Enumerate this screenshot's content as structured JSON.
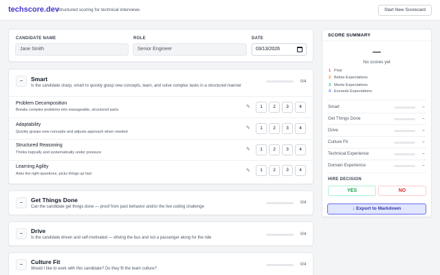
{
  "header": {
    "brand": "techscore.dev",
    "tagline": "Structured scoring for technical interviews",
    "new_button": "Start New Scorecard"
  },
  "candidate": {
    "name_label": "CANDIDATE NAME",
    "name_placeholder": "Jane Smith",
    "role_label": "ROLE",
    "role_placeholder": "Senior Engineer",
    "date_label": "DATE",
    "date_value": "03/13/2026"
  },
  "sections": [
    {
      "title": "Smart",
      "desc": "Is the candidate sharp, smart to quickly grasp new concepts, learn, and solve complex tasks in a structured manner",
      "count": "0/4",
      "collapse_glyph": "−",
      "criteria": [
        {
          "title": "Problem Decomposition",
          "desc": "Breaks complex problems into manageable, structured parts"
        },
        {
          "title": "Adaptability",
          "desc": "Quickly grasps new concepts and adjusts approach when needed"
        },
        {
          "title": "Structured Reasoning",
          "desc": "Thinks logically and systematically under pressure"
        },
        {
          "title": "Learning Agility",
          "desc": "Asks the right questions, picks things up fast"
        }
      ]
    },
    {
      "title": "Get Things Done",
      "desc": "Can the candidate get things done — proof from past behavior and/or the live coding challenge",
      "count": "0/4",
      "collapse_glyph": "−"
    },
    {
      "title": "Drive",
      "desc": "Is the candidate driven and self-motivated — driving the bus and not a passenger along for the ride",
      "count": "0/4",
      "collapse_glyph": "−"
    },
    {
      "title": "Culture Fit",
      "desc": "Would I like to work with this candidate? Do they fit the team culture?",
      "count": "0/4",
      "collapse_glyph": "−"
    }
  ],
  "score_options": [
    "1",
    "2",
    "3",
    "4"
  ],
  "pencil_glyph": "✎",
  "summary": {
    "title": "SCORE SUMMARY",
    "big_value": "—",
    "no_scores": "No scores yet",
    "legend": [
      {
        "num": "1",
        "label": "Poor",
        "color": "#ef4444"
      },
      {
        "num": "2",
        "label": "Below Expectations",
        "color": "#f97316"
      },
      {
        "num": "3",
        "label": "Meets Expectations",
        "color": "#10b981"
      },
      {
        "num": "4",
        "label": "Exceeds Expectations",
        "color": "#3b82f6"
      }
    ],
    "categories": [
      {
        "name": "Smart",
        "value": "–"
      },
      {
        "name": "Get Things Done",
        "value": "–"
      },
      {
        "name": "Drive",
        "value": "–"
      },
      {
        "name": "Culture Fit",
        "value": "–"
      },
      {
        "name": "Technical Experience",
        "value": "–"
      },
      {
        "name": "Domain Experience",
        "value": "–"
      }
    ],
    "hire_label": "HIRE DECISION",
    "yes": "YES",
    "no": "NO",
    "export": "↓ Export to Markdown"
  }
}
